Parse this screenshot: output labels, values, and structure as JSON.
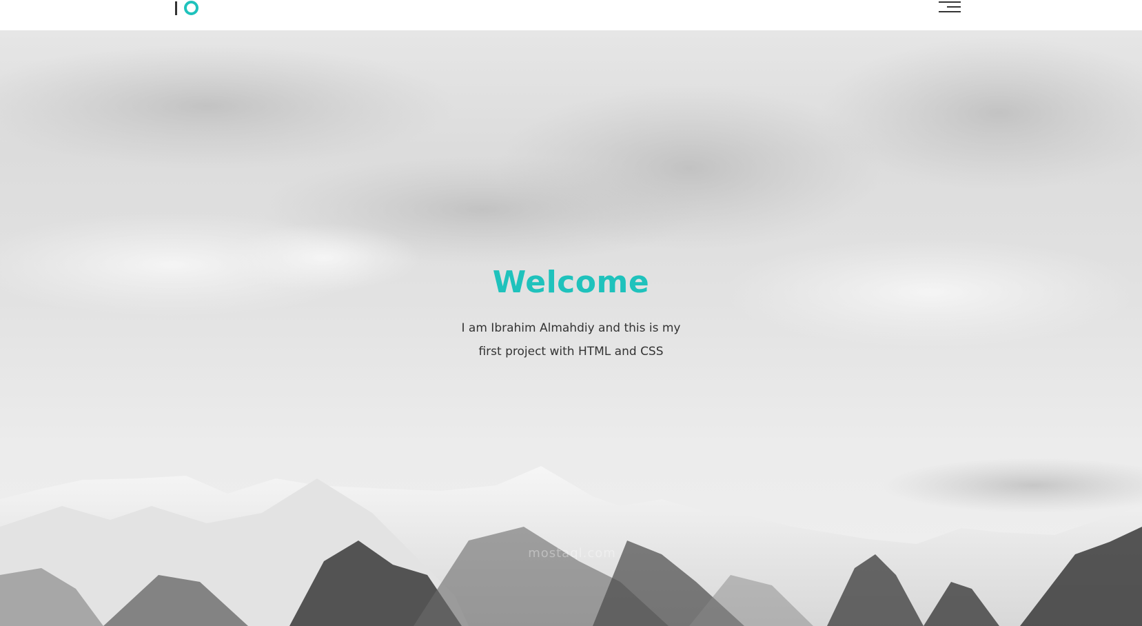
{
  "header": {
    "logo_icon": "io-logo-icon",
    "menu_icon": "hamburger-menu-icon"
  },
  "hero": {
    "title": "Welcome",
    "text": "I am Ibrahim Almahdiy and this is my first project with HTML and CSS",
    "background_image": "snowy-mountains-under-cloudy-sky"
  },
  "watermark": {
    "text": "mostaql.com"
  },
  "colors": {
    "accent": "#1fc2bc",
    "text": "#333333",
    "header_bg": "#ffffff"
  }
}
